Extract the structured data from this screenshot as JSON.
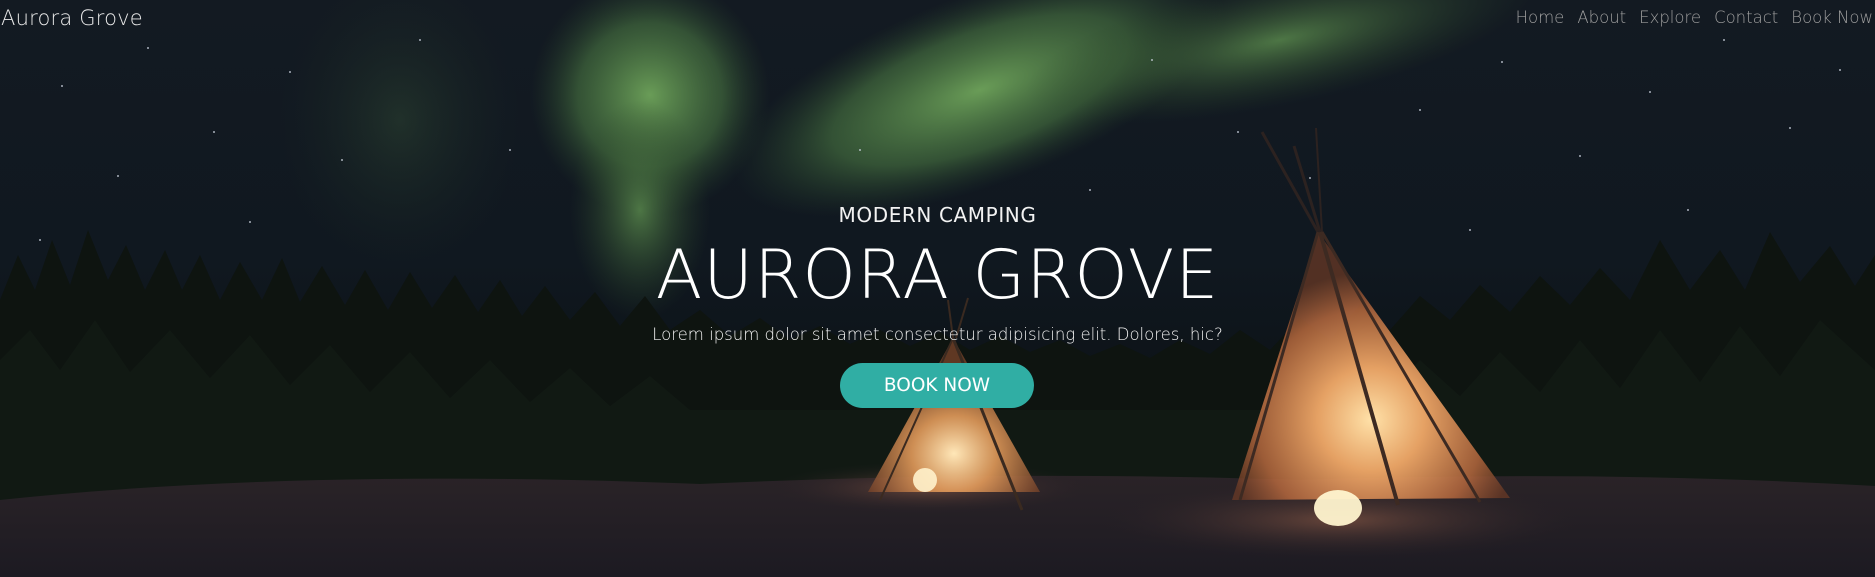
{
  "header": {
    "brand": "Aurora Grove",
    "nav": [
      "Home",
      "About",
      "Explore",
      "Contact",
      "Book Now"
    ]
  },
  "hero": {
    "eyebrow": "MODERN CAMPING",
    "title": "AURORA GROVE",
    "tagline": "Lorem ipsum dolor sit amet consectetur adipisicing elit. Dolores, hic?",
    "cta_label": "BOOK NOW"
  },
  "colors": {
    "accent": "#30aea4",
    "nav_text": "#9e9e9e",
    "hero_text": "#ffffff"
  }
}
